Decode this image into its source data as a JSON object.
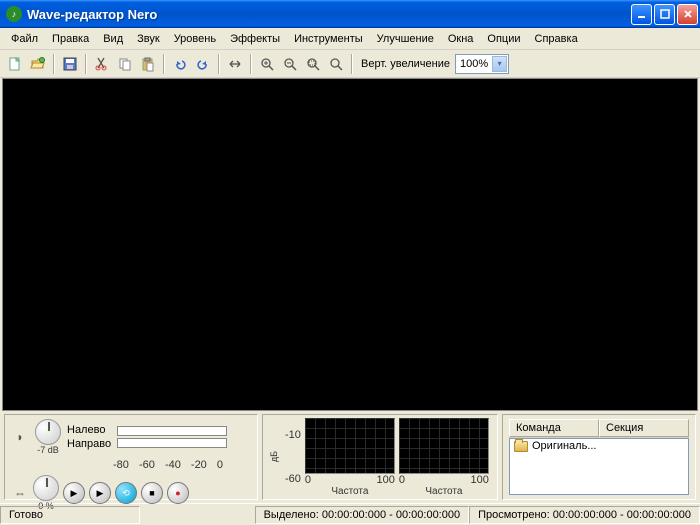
{
  "title": "Wave-редактор Nero",
  "menu": [
    "Файл",
    "Правка",
    "Вид",
    "Звук",
    "Уровень",
    "Эффекты",
    "Инструменты",
    "Улучшение",
    "Окна",
    "Опции",
    "Справка"
  ],
  "toolbar": {
    "zoom_label": "Верт. увеличение",
    "zoom_value": "100%"
  },
  "vu": {
    "left_label": "Налево",
    "right_label": "Направо",
    "knob1_label": "-7 dB",
    "knob2_label": "0 %",
    "scale": [
      "-80",
      "-60",
      "-40",
      "-20",
      "0"
    ]
  },
  "spectrum": {
    "y_ticks": [
      "-10",
      "-60"
    ],
    "x_ticks": [
      "0",
      "100"
    ],
    "x_label": "Частота",
    "db_unit": "дБ"
  },
  "list": {
    "headers": [
      "Команда",
      "Секция"
    ],
    "rows": [
      {
        "label": "Оригиналь...",
        "section": ""
      }
    ]
  },
  "status": {
    "ready": "Готово",
    "selection_label": "Выделено:",
    "selection_value": "00:00:00:000 - 00:00:00:000",
    "view_label": "Просмотрено:",
    "view_value": "00:00:00:000 - 00:00:00:000"
  }
}
